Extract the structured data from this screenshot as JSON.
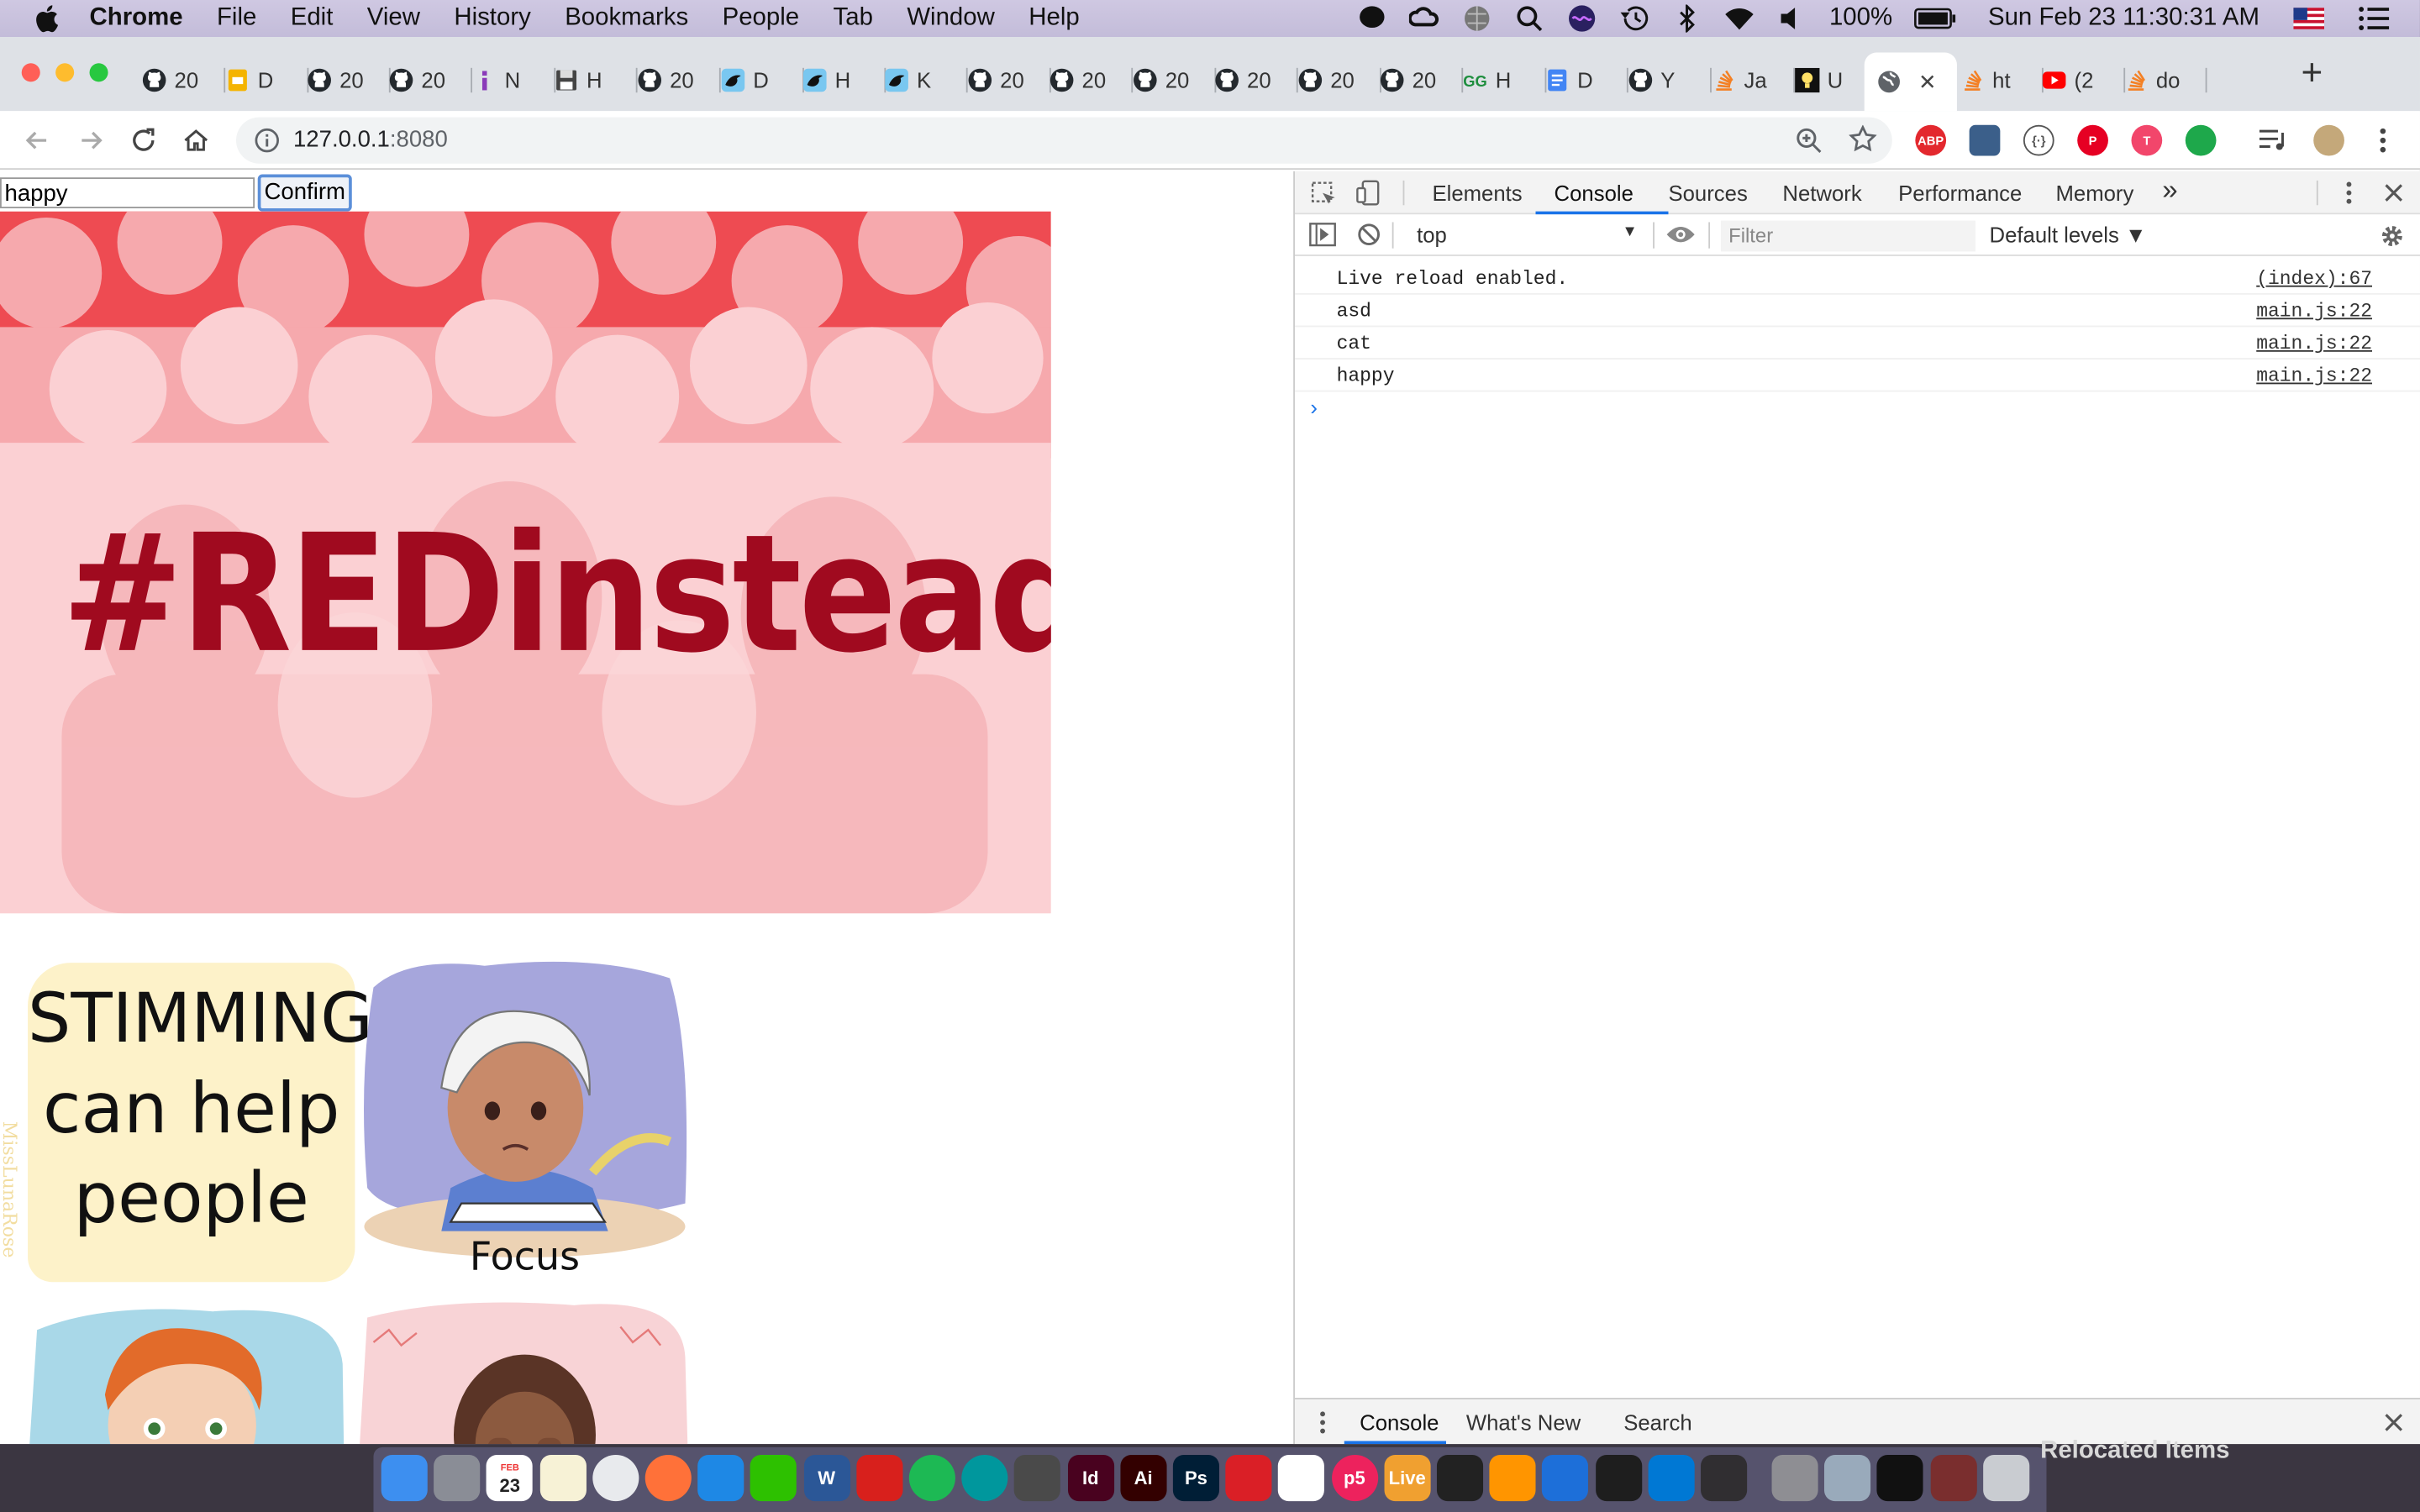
{
  "menubar": {
    "app_name": "Chrome",
    "items": [
      "File",
      "Edit",
      "View",
      "History",
      "Bookmarks",
      "People",
      "Tab",
      "Window",
      "Help"
    ],
    "battery": "100%",
    "clock": "Sun Feb 23  11:30:31 AM"
  },
  "tabs": [
    {
      "label": "20",
      "icon": "github-icon"
    },
    {
      "label": "D",
      "icon": "slides-icon"
    },
    {
      "label": "20",
      "icon": "github-icon"
    },
    {
      "label": "20",
      "icon": "github-icon"
    },
    {
      "label": "N",
      "icon": "info-icon"
    },
    {
      "label": "H",
      "icon": "floppy-icon"
    },
    {
      "label": "20",
      "icon": "github-icon"
    },
    {
      "label": "D",
      "icon": "bird-icon"
    },
    {
      "label": "H",
      "icon": "bird-icon"
    },
    {
      "label": "K",
      "icon": "bird-icon"
    },
    {
      "label": "20",
      "icon": "github-icon"
    },
    {
      "label": "20",
      "icon": "github-icon"
    },
    {
      "label": "20",
      "icon": "github-icon"
    },
    {
      "label": "20",
      "icon": "github-icon"
    },
    {
      "label": "20",
      "icon": "github-icon"
    },
    {
      "label": "20",
      "icon": "github-icon"
    },
    {
      "label": "H",
      "icon": "gg-icon"
    },
    {
      "label": "D",
      "icon": "docs-icon"
    },
    {
      "label": "Y",
      "icon": "github-icon"
    },
    {
      "label": "Ja",
      "icon": "stack-icon"
    },
    {
      "label": "U",
      "icon": "bulb-icon"
    },
    {
      "label": "",
      "icon": "globe-icon",
      "active": true
    },
    {
      "label": "ht",
      "icon": "stack-icon"
    },
    {
      "label": "(2",
      "icon": "youtube-icon"
    },
    {
      "label": "do",
      "icon": "stack-icon"
    }
  ],
  "address": {
    "host": "127.0.0.1",
    "port": ":8080"
  },
  "page": {
    "input_value": "happy",
    "confirm_label": "Confirm",
    "banner_text": "#REDinstead",
    "comic": {
      "panel1_line1": "STIMMING",
      "panel1_line2": "can help",
      "panel1_line3": "people",
      "panel2_caption": "Focus",
      "signature": "MissLunaRose"
    }
  },
  "devtools": {
    "tabs": [
      "Elements",
      "Console",
      "Sources",
      "Network",
      "Performance",
      "Memory"
    ],
    "active_tab": "Console",
    "more": "»",
    "context": "top",
    "filter_placeholder": "Filter",
    "levels": "Default levels ▼",
    "logs": [
      {
        "message": "Live reload enabled.",
        "source": "(index):67"
      },
      {
        "message": "asd",
        "source": "main.js:22"
      },
      {
        "message": "cat",
        "source": "main.js:22"
      },
      {
        "message": "happy",
        "source": "main.js:22"
      }
    ],
    "prompt": "›",
    "drawer_tabs": [
      "Console",
      "What's New",
      "Search"
    ]
  },
  "dock": {
    "relocated_label": "Relocated Items",
    "calendar_month": "FEB",
    "calendar_day": "23",
    "apps": [
      {
        "name": "finder",
        "label": "",
        "color": "#3d8ff0"
      },
      {
        "name": "launchpad",
        "label": "",
        "color": "#8a8d96"
      },
      {
        "name": "calendar",
        "label": "23",
        "color": "#ffffff"
      },
      {
        "name": "notes",
        "label": "",
        "color": "#f7f2d6"
      },
      {
        "name": "chrome",
        "label": "",
        "color": "#e8eaed"
      },
      {
        "name": "firefox",
        "label": "",
        "color": "#ff7139"
      },
      {
        "name": "safari",
        "label": "",
        "color": "#1e88e5"
      },
      {
        "name": "wechat",
        "label": "",
        "color": "#2dc100"
      },
      {
        "name": "word",
        "label": "W",
        "color": "#2b5797"
      },
      {
        "name": "acrobat",
        "label": "",
        "color": "#d8201c"
      },
      {
        "name": "spotify",
        "label": "",
        "color": "#1db954"
      },
      {
        "name": "arduino",
        "label": "",
        "color": "#00979d"
      },
      {
        "name": "sublime",
        "label": "",
        "color": "#4a4a4a"
      },
      {
        "name": "indesign",
        "label": "Id",
        "color": "#49021f"
      },
      {
        "name": "illustrator",
        "label": "Ai",
        "color": "#330000"
      },
      {
        "name": "photoshop",
        "label": "Ps",
        "color": "#001e36"
      },
      {
        "name": "creative-cloud",
        "label": "",
        "color": "#da1f26"
      },
      {
        "name": "slack",
        "label": "",
        "color": "#ffffff"
      },
      {
        "name": "p5",
        "label": "p5",
        "color": "#ed225d"
      },
      {
        "name": "live-server",
        "label": "Live",
        "color": "#f0a030"
      },
      {
        "name": "terminal-app",
        "label": "",
        "color": "#222222"
      },
      {
        "name": "books",
        "label": "",
        "color": "#ff9500"
      },
      {
        "name": "sourcetree",
        "label": "",
        "color": "#1d6fd9"
      },
      {
        "name": "figma",
        "label": "",
        "color": "#1e1e1e"
      },
      {
        "name": "vscode",
        "label": "",
        "color": "#0078d4"
      },
      {
        "name": "obs",
        "label": "",
        "color": "#302e31"
      },
      {
        "name": "system-prefs",
        "label": "",
        "color": "#8e8e93"
      },
      {
        "name": "preview",
        "label": "",
        "color": "#9ab"
      },
      {
        "name": "terminal",
        "label": "",
        "color": "#111111"
      },
      {
        "name": "node-window",
        "label": "",
        "color": "#7a2e2e"
      },
      {
        "name": "trash",
        "label": "",
        "color": "#c9ccd1"
      }
    ]
  }
}
